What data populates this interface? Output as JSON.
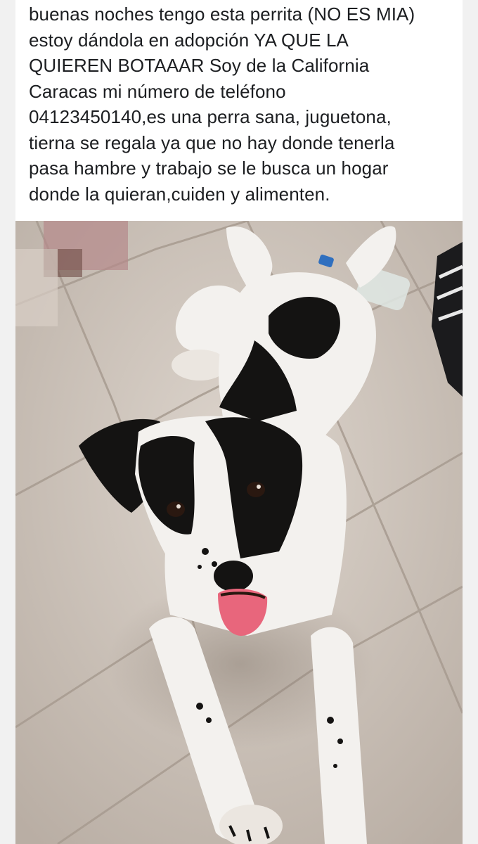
{
  "post": {
    "text": "buenas noches tengo esta perrita (NO ES MIA)\nestoy dándola en adopción YA QUE LA\nQUIEREN BOTAAAR Soy de la California\nCaracas mi número de teléfono\n04123450140,es una perra sana, juguetona,\ntierna se regala ya que no hay donde tenerla\npasa hambre y trabajo se le busca un hogar\ndonde la quieran,cuiden y alimenten."
  },
  "photo": {
    "colors": {
      "floor": "#cfc5bc",
      "floor_light": "#ddd5cd",
      "grout": "#a79b90",
      "fur_white": "#f3f1ee",
      "fur_black": "#141312",
      "tongue": "#e8667c"
    }
  }
}
